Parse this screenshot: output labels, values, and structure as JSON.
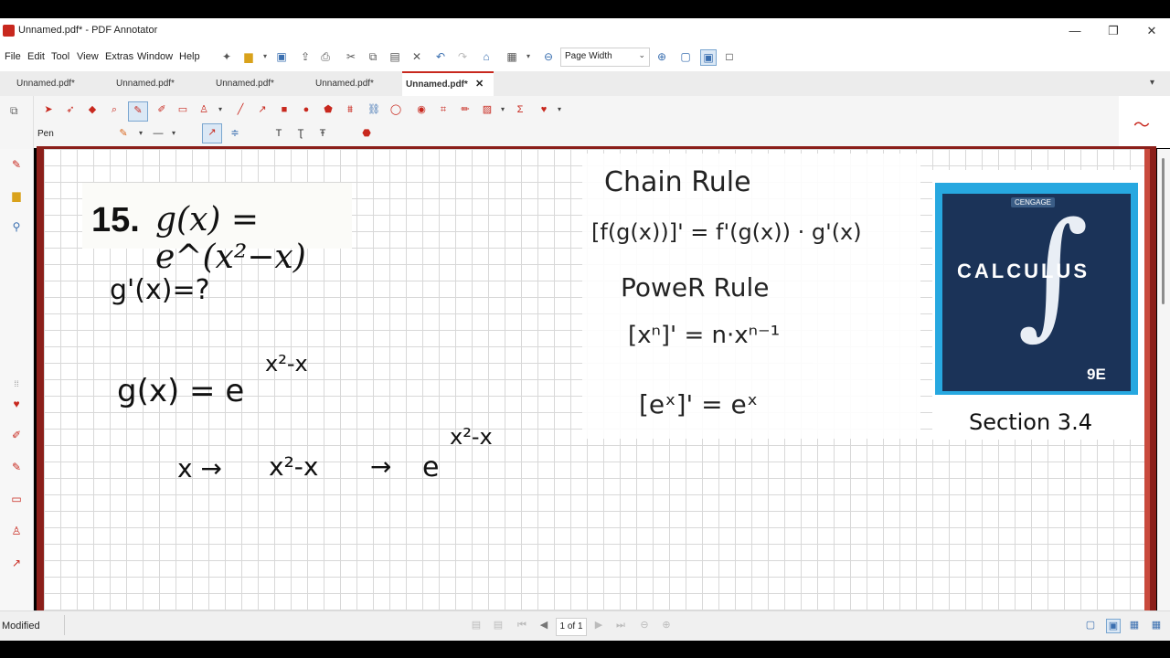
{
  "window": {
    "title": "Unnamed.pdf* - PDF Annotator",
    "minimize": "—",
    "maximize": "❐",
    "close": "✕"
  },
  "menu": {
    "items": [
      "File",
      "Edit",
      "Tool",
      "View",
      "Extras",
      "Window",
      "Help"
    ],
    "underline_letters": [
      "F",
      "E",
      "T",
      "V",
      "x",
      "W",
      "H"
    ]
  },
  "toolbar": {
    "zoom_value": "Page Width"
  },
  "tabs": {
    "items": [
      {
        "label": "Unnamed.pdf*"
      },
      {
        "label": "Unnamed.pdf*"
      },
      {
        "label": "Unnamed.pdf*"
      },
      {
        "label": "Unnamed.pdf*"
      },
      {
        "label": "Unnamed.pdf*"
      }
    ],
    "active_index": 4,
    "close_glyph": "✕",
    "dropdown_glyph": "▾"
  },
  "tool_options": {
    "active_tool_label": "Pen"
  },
  "document": {
    "problem_number": "15.",
    "problem_expression": "g(x) = e^(x²−x)",
    "handwriting": {
      "question": "g'(x)=?",
      "function": "g(x) = e",
      "function_exponent": "x²-x",
      "chain_x": "x →",
      "chain_inner": "x²-x",
      "chain_arrow": "→",
      "chain_e": "e",
      "chain_exponent": "x²-x",
      "chain_rule_title": "Chain Rule",
      "chain_rule_formula": "[f(g(x))]' = f'(g(x)) · g'(x)",
      "power_rule_title": "PoweR Rule",
      "power_rule_formula": "[xⁿ]' = n·xⁿ⁻¹",
      "exp_rule_formula": "[eˣ]' = eˣ",
      "section_label": "Section 3.4"
    },
    "book_cover": {
      "brand": "CENGAGE",
      "title": "CALCULUS",
      "edition": "9E"
    }
  },
  "status": {
    "text": "Modified",
    "page_indicator": "1 of 1"
  },
  "colors": {
    "accent": "#c8281e",
    "frame": "#8b1f1a",
    "cover_blue": "#27a8e0"
  }
}
